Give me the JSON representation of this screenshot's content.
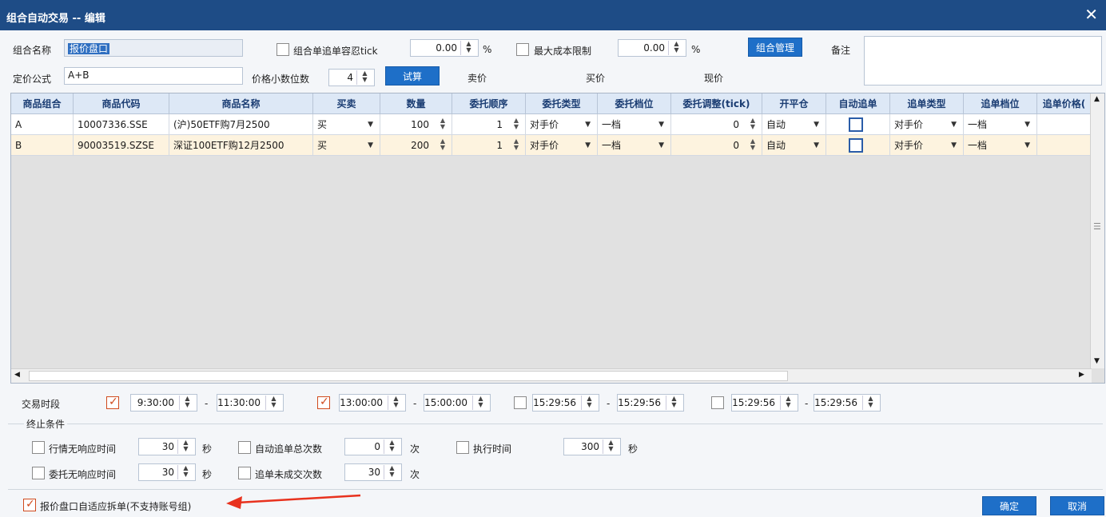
{
  "window": {
    "title": "组合自动交易 -- 编辑",
    "close": "✕"
  },
  "form": {
    "name_label": "组合名称",
    "name_value": "报价盘口",
    "tolerance_label": "组合单追单容忍tick",
    "tolerance_value": "0.00",
    "tolerance_unit": "%",
    "maxcost_label": "最大成本限制",
    "maxcost_value": "0.00",
    "maxcost_unit": "%",
    "manage_button": "组合管理",
    "remark_label": "备注",
    "formula_label": "定价公式",
    "formula_value": "A+B",
    "decimals_label": "价格小数位数",
    "decimals_value": "4",
    "calc_button": "试算",
    "sell_label": "卖价",
    "buy_label": "买价",
    "current_label": "现价"
  },
  "table": {
    "headers": [
      "商品组合",
      "商品代码",
      "商品名称",
      "买卖",
      "数量",
      "委托顺序",
      "委托类型",
      "委托档位",
      "委托调整(tick)",
      "开平仓",
      "自动追单",
      "追单类型",
      "追单档位",
      "追单价格("
    ],
    "rows": [
      {
        "combo": "A",
        "code": "10007336.SSE",
        "name": "(沪)50ETF购7月2500",
        "side": "买",
        "qty": "100",
        "order": "1",
        "otype": "对手价",
        "olevel": "一档",
        "adjust": "0",
        "openclose": "自动",
        "otype2": "对手价",
        "olevel2": "一档"
      },
      {
        "combo": "B",
        "code": "90003519.SZSE",
        "name": "深证100ETF购12月2500",
        "side": "买",
        "qty": "200",
        "order": "1",
        "otype": "对手价",
        "olevel": "一档",
        "adjust": "0",
        "openclose": "自动",
        "otype2": "对手价",
        "olevel2": "一档"
      }
    ]
  },
  "session": {
    "label": "交易时段",
    "dash": "-",
    "slots": [
      {
        "checked": true,
        "start": "9:30:00",
        "end": "11:30:00"
      },
      {
        "checked": true,
        "start": "13:00:00",
        "end": "15:00:00"
      },
      {
        "checked": false,
        "start": "15:29:56",
        "end": "15:29:56"
      },
      {
        "checked": false,
        "start": "15:29:56",
        "end": "15:29:56"
      }
    ]
  },
  "stop": {
    "title": "终止条件",
    "c1_label": "行情无响应时间",
    "c1_value": "30",
    "c1_unit": "秒",
    "c2_label": "自动追单总次数",
    "c2_value": "0",
    "c2_unit": "次",
    "c3_label": "执行时间",
    "c3_value": "300",
    "c3_unit": "秒",
    "c4_label": "委托无响应时间",
    "c4_value": "30",
    "c4_unit": "秒",
    "c5_label": "追单未成交次数",
    "c5_value": "30",
    "c5_unit": "次"
  },
  "footer": {
    "split_label": "报价盘口自适应拆单(不支持账号组)",
    "split_checked": true,
    "ok_button": "确定",
    "cancel_button": "取消"
  },
  "colors": {
    "title_bg": "#1e4c86",
    "button_blue": "#1e6fc8",
    "row_highlight": "#fdf3df",
    "annotation_arrow": "#e8321e"
  }
}
